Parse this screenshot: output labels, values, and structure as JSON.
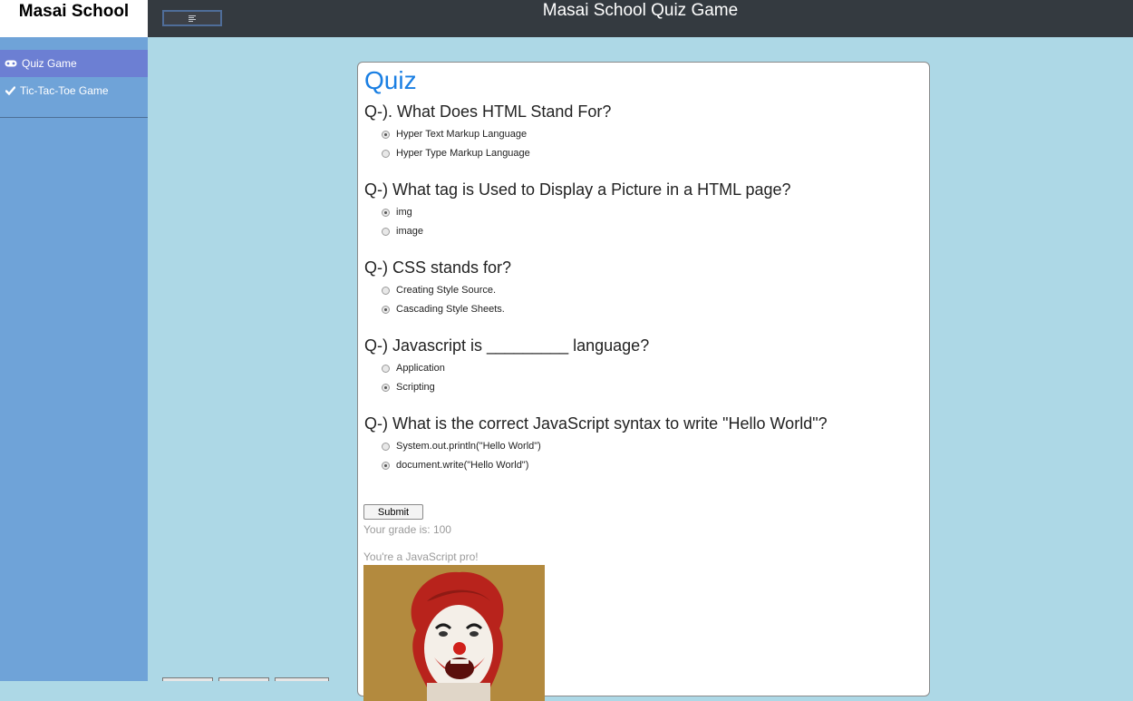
{
  "brand": {
    "name": "Masai School"
  },
  "header": {
    "title": "Masai School Quiz Game",
    "menu_icon": "hamburger-icon"
  },
  "sidebar": {
    "items": [
      {
        "label": "Quiz Game",
        "icon": "gamepad-icon",
        "active": true
      },
      {
        "label": "Tic-Tac-Toe Game",
        "icon": "check-icon",
        "active": false
      }
    ]
  },
  "quiz": {
    "title": "Quiz",
    "questions": [
      {
        "text": "Q-). What Does HTML Stand For?",
        "options": [
          "Hyper Text Markup Language",
          "Hyper Type Markup Language"
        ],
        "selected": 0
      },
      {
        "text": "Q-) What tag is Used to Display a Picture in a HTML page?",
        "options": [
          "img",
          "image"
        ],
        "selected": 0
      },
      {
        "text": "Q-) CSS stands for?",
        "options": [
          "Creating Style Source.",
          "Cascading Style Sheets."
        ],
        "selected": 1
      },
      {
        "text": "Q-) Javascript is _________ language?",
        "options": [
          "Application",
          "Scripting"
        ],
        "selected": 1
      },
      {
        "text": "Q-) What is the correct JavaScript syntax to write \"Hello World\"?",
        "options": [
          "System.out.println(\"Hello World\")",
          "document.write(\"Hello World\")"
        ],
        "selected": 1
      }
    ],
    "submit_label": "Submit",
    "grade_text": "Your grade is: 100",
    "result_text": "You're a JavaScript pro!"
  },
  "colors": {
    "background": "#add8e6",
    "topbar": "#343a40",
    "sidebar": "#6fa3d8",
    "sidebar_active": "#6c7fd3",
    "quiz_title": "#1a7fe3"
  }
}
